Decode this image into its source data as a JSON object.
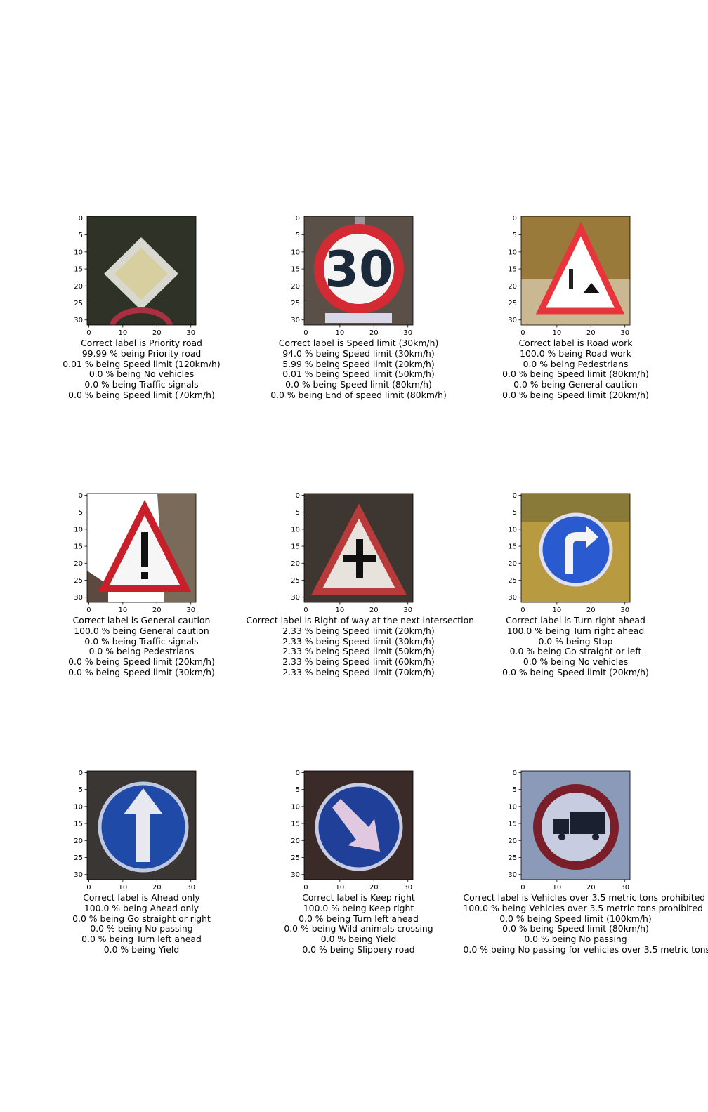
{
  "axis_ticks": {
    "x": [
      "0",
      "10",
      "20",
      "30"
    ],
    "y": [
      "0",
      "5",
      "10",
      "15",
      "20",
      "25",
      "30"
    ]
  },
  "panels": [
    {
      "sign": "priority-road",
      "colors": {
        "bg": "#2f3226",
        "accent": "#d8cfa0"
      },
      "lines": [
        "Correct label is Priority road",
        "99.99 % being Priority road",
        "0.01 % being Speed limit (120km/h)",
        "0.0 % being No vehicles",
        "0.0 % being Traffic signals",
        "0.0 % being Speed limit (70km/h)"
      ]
    },
    {
      "sign": "speed-limit-30",
      "colors": {
        "bg": "#5a5048",
        "accent": "#d42a33"
      },
      "lines": [
        "Correct label is Speed limit (30km/h)",
        "94.0 % being Speed limit (30km/h)",
        "5.99 % being Speed limit (20km/h)",
        "0.01 % being Speed limit (50km/h)",
        "0.0 % being Speed limit (80km/h)",
        "0.0 % being End of speed limit (80km/h)"
      ]
    },
    {
      "sign": "road-work",
      "colors": {
        "bg": "#9a7a3a",
        "accent": "#e8353c"
      },
      "lines": [
        "Correct label is Road work",
        "100.0 % being Road work",
        "0.0 % being Pedestrians",
        "0.0 % being Speed limit (80km/h)",
        "0.0 % being General caution",
        "0.0 % being Speed limit (20km/h)"
      ]
    },
    {
      "sign": "general-caution",
      "colors": {
        "bg": "#ffffff",
        "accent": "#c8202b"
      },
      "lines": [
        "Correct label is General caution",
        "100.0 % being General caution",
        "0.0 % being Traffic signals",
        "0.0 % being Pedestrians",
        "0.0 % being Speed limit (20km/h)",
        "0.0 % being Speed limit (30km/h)"
      ]
    },
    {
      "sign": "right-of-way",
      "colors": {
        "bg": "#3e3630",
        "accent": "#b83a3a"
      },
      "lines": [
        "Correct label is Right-of-way at the next intersection",
        "2.33 % being Speed limit (20km/h)",
        "2.33 % being Speed limit (30km/h)",
        "2.33 % being Speed limit (50km/h)",
        "2.33 % being Speed limit (60km/h)",
        "2.33 % being Speed limit (70km/h)"
      ]
    },
    {
      "sign": "turn-right-ahead",
      "colors": {
        "bg": "#b89a40",
        "accent": "#2a5ad0"
      },
      "lines": [
        "Correct label is Turn right ahead",
        "100.0 % being Turn right ahead",
        "0.0 % being Stop",
        "0.0 % being Go straight or left",
        "0.0 % being No vehicles",
        "0.0 % being Speed limit (20km/h)"
      ]
    },
    {
      "sign": "ahead-only",
      "colors": {
        "bg": "#3a3634",
        "accent": "#1f4aa8"
      },
      "lines": [
        "Correct label is Ahead only",
        "100.0 % being Ahead only",
        "0.0 % being Go straight or right",
        "0.0 % being No passing",
        "0.0 % being Turn left ahead",
        "0.0 % being Yield"
      ]
    },
    {
      "sign": "keep-right",
      "colors": {
        "bg": "#3a2a28",
        "accent": "#1f3f98"
      },
      "lines": [
        "Correct label is Keep right",
        "100.0 % being Keep right",
        "0.0 % being Turn left ahead",
        "0.0 % being Wild animals crossing",
        "0.0 % being Yield",
        "0.0 % being Slippery road"
      ]
    },
    {
      "sign": "vehicles-over-3-5-tons",
      "colors": {
        "bg": "#8a9ab8",
        "accent": "#7a1f2a"
      },
      "lines": [
        "Correct label is Vehicles over 3.5 metric tons prohibited",
        "100.0 % being Vehicles over 3.5 metric tons prohibited",
        "0.0 % being Speed limit (100km/h)",
        "0.0 % being Speed limit (80km/h)",
        "0.0 % being No passing",
        "0.0 % being No passing for vehicles over 3.5 metric tons"
      ]
    }
  ]
}
